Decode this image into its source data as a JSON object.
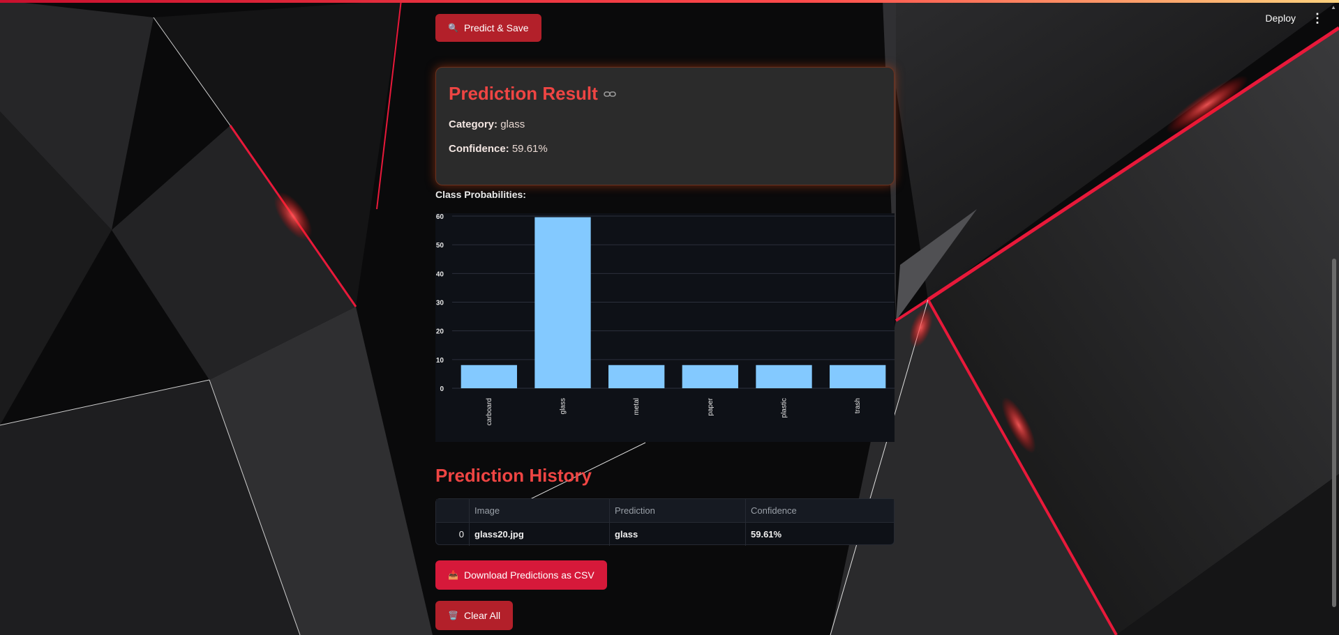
{
  "topbar": {
    "deploy_label": "Deploy",
    "menu_icon": "kebab-menu-icon"
  },
  "actions": {
    "predict_label": "Predict & Save",
    "predict_icon": "🔍",
    "download_label": "Download Predictions as CSV",
    "download_icon": "📥",
    "clear_label": "Clear All",
    "clear_icon": "🗑️"
  },
  "result": {
    "title": "Prediction Result",
    "category_label": "Category:",
    "category_value": "glass",
    "confidence_label": "Confidence:",
    "confidence_value": "59.61%"
  },
  "chart_section": {
    "label": "Class Probabilities:"
  },
  "chart_data": {
    "type": "bar",
    "categories": [
      "carboard",
      "glass",
      "metal",
      "paper",
      "plastic",
      "trash"
    ],
    "values": [
      8.08,
      59.61,
      8.08,
      8.08,
      8.08,
      8.08
    ],
    "title": "",
    "xlabel": "",
    "ylabel": "",
    "ylim": [
      0,
      60
    ],
    "yticks": [
      0,
      10,
      20,
      30,
      40,
      50,
      60
    ],
    "grid": true,
    "bar_color": "#83c9ff"
  },
  "history": {
    "title": "Prediction History",
    "columns": [
      "",
      "Image",
      "Prediction",
      "Confidence"
    ],
    "rows": [
      {
        "index": "0",
        "image": "glass20.jpg",
        "prediction": "glass",
        "confidence": "59.61%"
      }
    ]
  },
  "colors": {
    "accent": "#ef4543",
    "button": "#b3202a",
    "button_bright": "#d6193a",
    "card_bg": "#2b2b2b",
    "chart_bg": "#0e1117"
  }
}
